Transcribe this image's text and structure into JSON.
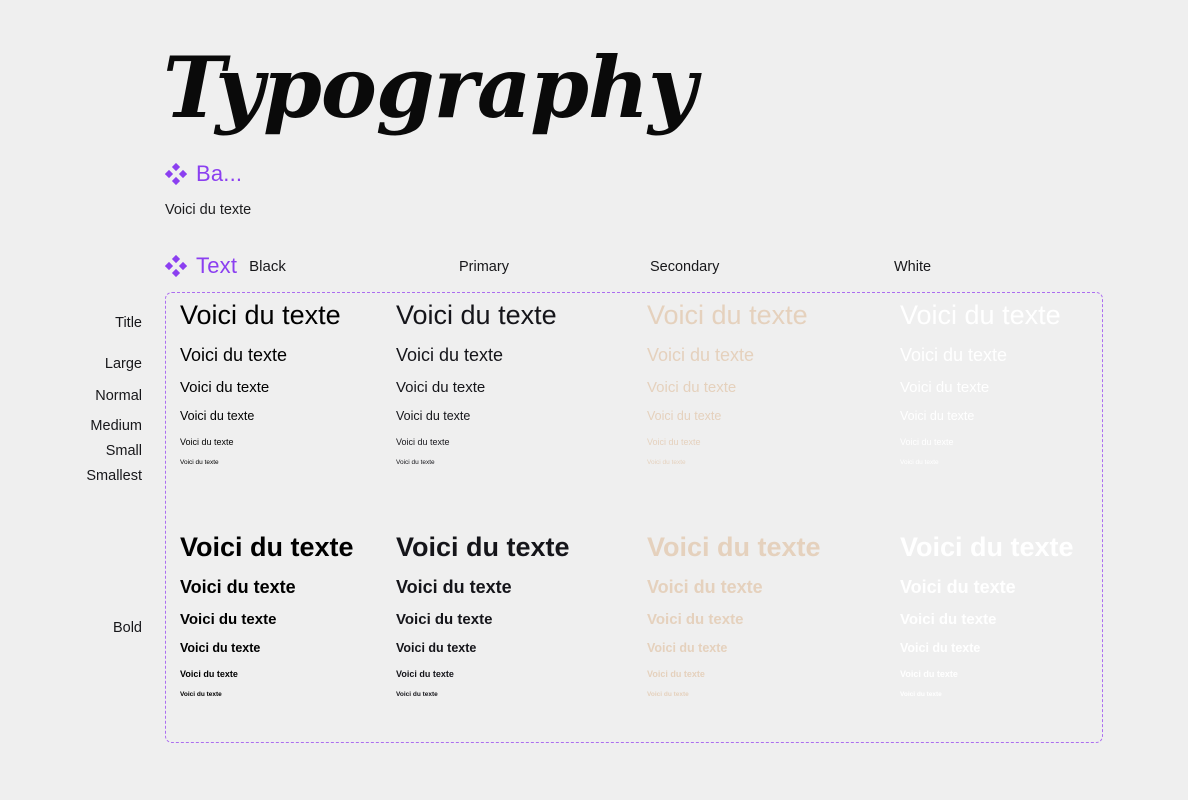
{
  "page": {
    "title": "Typography",
    "background": "#efefef"
  },
  "accent": {
    "purple": "#8b3ff0",
    "frame_dashed": "#ac6ef0"
  },
  "sections": {
    "basics": {
      "icon": "diamond-cluster-icon",
      "title": "Ba...",
      "sample": "Voici du texte"
    },
    "text": {
      "icon": "diamond-cluster-icon",
      "title": "Text",
      "suffix": "Black"
    }
  },
  "columns": [
    {
      "label": "Black",
      "color": "#000000"
    },
    {
      "label": "Primary",
      "color": "#15151a"
    },
    {
      "label": "Secondary",
      "color": "#e5d1bd"
    },
    {
      "label": "White",
      "color": "#ffffff"
    }
  ],
  "rows": [
    {
      "label": "Title"
    },
    {
      "label": "Large"
    },
    {
      "label": "Normal"
    },
    {
      "label": "Medium"
    },
    {
      "label": "Small"
    },
    {
      "label": "Smallest"
    }
  ],
  "weights": [
    {
      "label": "",
      "name": "regular"
    },
    {
      "label": "Bold",
      "name": "bold"
    }
  ],
  "sample_text": "Voici du texte",
  "samples": {
    "regular": {
      "black": [
        "Voici du texte",
        "Voici du texte",
        "Voici du texte",
        "Voici du texte",
        "Voici du texte",
        "Voici du texte"
      ],
      "primary": [
        "Voici du texte",
        "Voici du texte",
        "Voici du texte",
        "Voici du texte",
        "Voici du texte",
        "Voici du texte"
      ],
      "secondary": [
        "Voici du texte",
        "Voici du texte",
        "Voici du texte",
        "Voici du texte",
        "Voici du texte",
        "Voici du texte"
      ],
      "white": [
        "Voici du texte",
        "Voici du texte",
        "Voici du texte",
        "Voici du texte",
        "Voici du texte",
        "Voici du texte"
      ]
    },
    "bold": {
      "black": [
        "Voici du texte",
        "Voici du texte",
        "Voici du texte",
        "Voici du texte",
        "Voici du texte",
        "Voici du texte"
      ],
      "primary": [
        "Voici du texte",
        "Voici du texte",
        "Voici du texte",
        "Voici du texte",
        "Voici du texte",
        "Voici du texte"
      ],
      "secondary": [
        "Voici du texte",
        "Voici du texte",
        "Voici du texte",
        "Voici du texte",
        "Voici du texte",
        "Voici du texte"
      ],
      "white": [
        "Voici du texte",
        "Voici du texte",
        "Voici du texte",
        "Voici du texte",
        "Voici du texte",
        "Voici du texte"
      ]
    }
  },
  "row_label_positions": {
    "title": 315,
    "large": 356,
    "normal": 388,
    "medium": 418,
    "small": 443,
    "smallest": 468,
    "bold": 620
  }
}
